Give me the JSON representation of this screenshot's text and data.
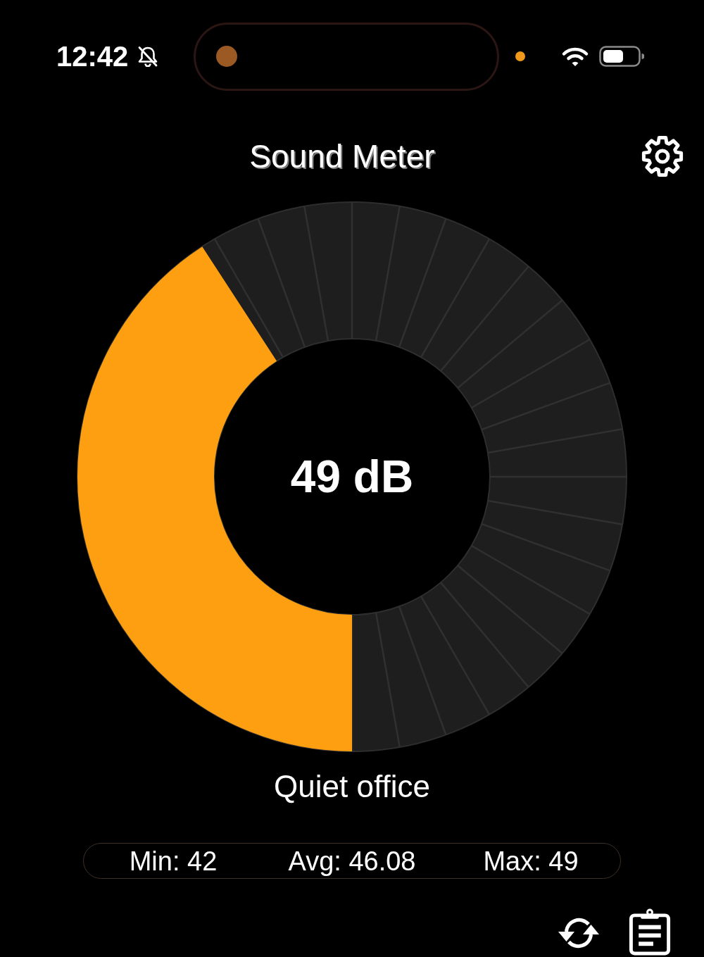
{
  "status_bar": {
    "time": "12:42"
  },
  "header": {
    "title": "Sound Meter"
  },
  "gauge": {
    "level": 0.408,
    "reading": "49 dB"
  },
  "description": "Quiet office",
  "stats": [
    {
      "text": "Min: 42"
    },
    {
      "text": "Avg: 46.08"
    },
    {
      "text": "Max: 49"
    }
  ]
}
